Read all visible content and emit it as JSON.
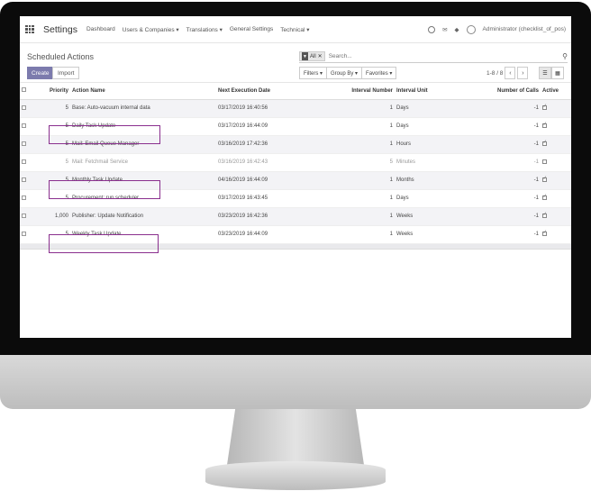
{
  "navbar": {
    "app_title": "Settings",
    "menu": [
      "Dashboard",
      "Users & Companies ▾",
      "Translations ▾",
      "General Settings",
      "Technical ▾"
    ],
    "user": "Administrator (checklist_of_pos)"
  },
  "control": {
    "breadcrumb": "Scheduled Actions",
    "facet_label": "All",
    "search_placeholder": "Search...",
    "create_label": "Create",
    "import_label": "Import",
    "filters_label": "Filters ▾",
    "groupby_label": "Group By ▾",
    "favorites_label": "Favorites ▾",
    "pager": "1-8 / 8"
  },
  "table": {
    "headers": {
      "priority": "Priority",
      "name": "Action Name",
      "next": "Next Execution Date",
      "interval_number": "Interval Number",
      "interval_unit": "Interval Unit",
      "calls": "Number of Calls",
      "active": "Active"
    },
    "rows": [
      {
        "priority": "5",
        "name": "Base: Auto-vacuum internal data",
        "next": "03/17/2019 16:40:56",
        "interval": "1",
        "unit": "Days",
        "calls": "-1",
        "active": true
      },
      {
        "priority": "5",
        "name": "Daily Task Update",
        "next": "03/17/2019 16:44:09",
        "interval": "1",
        "unit": "Days",
        "calls": "-1",
        "active": true
      },
      {
        "priority": "5",
        "name": "Mail: Email Queue Manager",
        "next": "03/16/2019 17:42:36",
        "interval": "1",
        "unit": "Hours",
        "calls": "-1",
        "active": true
      },
      {
        "priority": "5",
        "name": "Mail: Fetchmail Service",
        "next": "03/16/2019 16:42:43",
        "interval": "5",
        "unit": "Minutes",
        "calls": "-1",
        "active": false
      },
      {
        "priority": "5",
        "name": "Monthly Task Update",
        "next": "04/16/2019 16:44:09",
        "interval": "1",
        "unit": "Months",
        "calls": "-1",
        "active": true
      },
      {
        "priority": "5",
        "name": "Procurement: run scheduler",
        "next": "03/17/2019 16:43:45",
        "interval": "1",
        "unit": "Days",
        "calls": "-1",
        "active": true
      },
      {
        "priority": "1,000",
        "name": "Publisher: Update Notification",
        "next": "03/23/2019 16:42:36",
        "interval": "1",
        "unit": "Weeks",
        "calls": "-1",
        "active": true
      },
      {
        "priority": "5",
        "name": "Weekly Task Update",
        "next": "03/23/2019 16:44:09",
        "interval": "1",
        "unit": "Weeks",
        "calls": "-1",
        "active": true
      }
    ]
  },
  "colors": {
    "create_button": "#7c7bad",
    "highlight_box": "#8a2f8e"
  }
}
